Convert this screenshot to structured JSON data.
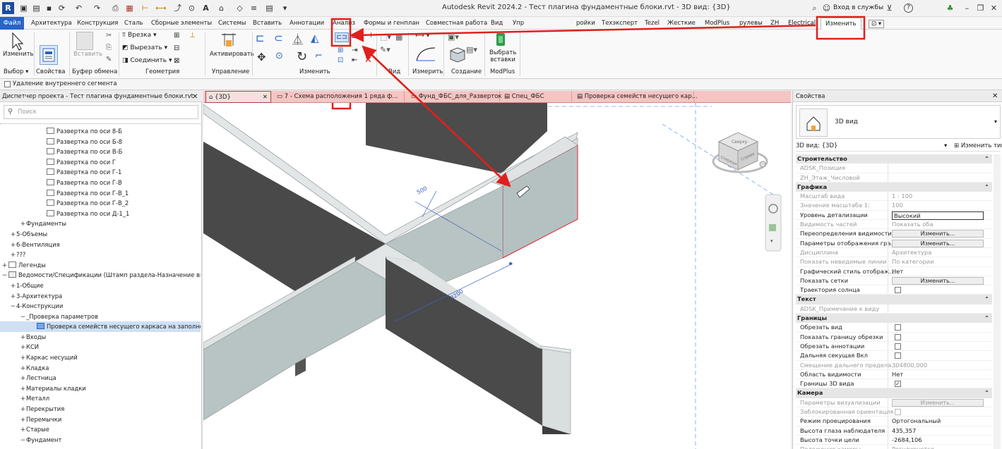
{
  "window": {
    "title": "Autodesk Revit 2024.2 - Тест плагина фундаментные блоки.rvt - 3D вид: {3D}",
    "sign_in": "Вход в службы",
    "help_icon": "?"
  },
  "ribbon_tabs": {
    "file": "Файл",
    "items": [
      "Архитектура",
      "Конструкция",
      "Сталь",
      "Сборные элементы",
      "Системы",
      "Вставить",
      "Аннотации",
      "Анализ",
      "Формы и генплан",
      "Совместная работа",
      "Вид",
      "Упр",
      "ройки",
      "Техэксперт",
      "Tezel",
      "Жесткие",
      "ModPlus",
      "рулевы",
      "ZH",
      "Electrical"
    ],
    "active": "Изменить"
  },
  "ribbon": {
    "modify_label": "Изменить",
    "paste_label": "Вставить",
    "cut_label": "Врезка",
    "cut2_label": "Вырезать",
    "join_label": "Соединить",
    "activate_label": "Активировать",
    "measure_label": "Измерить",
    "create_label": "Создание",
    "select_insert_label1": "Выбрать",
    "select_insert_label2": "вставки",
    "panels": {
      "select": "Выбор",
      "properties": "Свойства",
      "clipboard": "Буфер обмена",
      "geometry": "Геометрия",
      "control": "Управление",
      "modify": "Изменить",
      "view": "Вид",
      "measure": "Измерить",
      "create": "Создание",
      "modplus": "ModPlus"
    }
  },
  "options_bar": {
    "checkbox_label": "Удаление внутреннего сегмента"
  },
  "project_browser": {
    "header": "Диспетчер проекта - Тест плагина фундаментные блоки.rvt",
    "search_placeholder": "Поиск",
    "rows": [
      {
        "indent": 56,
        "toggle": "",
        "icon": "sheet",
        "label": "Развертка по оси 8-Б"
      },
      {
        "indent": 56,
        "toggle": "",
        "icon": "sheet",
        "label": "Развертка по оси Б-8"
      },
      {
        "indent": 56,
        "toggle": "",
        "icon": "sheet",
        "label": "Развертка по оси В-Б"
      },
      {
        "indent": 56,
        "toggle": "",
        "icon": "sheet",
        "label": "Развертка по оси Г"
      },
      {
        "indent": 56,
        "toggle": "",
        "icon": "sheet",
        "label": "Развертка по оси Г-1"
      },
      {
        "indent": 56,
        "toggle": "",
        "icon": "sheet",
        "label": "Развертка по оси Г-В"
      },
      {
        "indent": 56,
        "toggle": "",
        "icon": "sheet",
        "label": "Развертка по оси Г-В_1"
      },
      {
        "indent": 56,
        "toggle": "",
        "icon": "sheet",
        "label": "Развертка по оси Г-В_2"
      },
      {
        "indent": 56,
        "toggle": "",
        "icon": "sheet",
        "label": "Развертка по оси Д-1_1"
      },
      {
        "indent": 28,
        "toggle": "+",
        "icon": "",
        "label": "Фундаменты"
      },
      {
        "indent": 14,
        "toggle": "+",
        "icon": "",
        "label": "5-Объемы"
      },
      {
        "indent": 14,
        "toggle": "+",
        "icon": "",
        "label": "6-Вентиляция"
      },
      {
        "indent": 14,
        "toggle": "+",
        "icon": "",
        "label": "???"
      },
      {
        "indent": 2,
        "toggle": "+",
        "icon": "legend",
        "label": "Легенды"
      },
      {
        "indent": 2,
        "toggle": "−",
        "icon": "schedule",
        "label": "Ведомости/Спецификации (Штамп раздела-Назначение вид"
      },
      {
        "indent": 14,
        "toggle": "+",
        "icon": "",
        "label": "1-Общие"
      },
      {
        "indent": 14,
        "toggle": "+",
        "icon": "",
        "label": "3-Архитектура"
      },
      {
        "indent": 14,
        "toggle": "−",
        "icon": "",
        "label": "4-Конструкции"
      },
      {
        "indent": 28,
        "toggle": "−",
        "icon": "",
        "label": "_Проверка параметров"
      },
      {
        "indent": 42,
        "toggle": "",
        "icon": "schedule-sel",
        "label": "Проверка семейств несущего каркаса на заполнен",
        "selected": true
      },
      {
        "indent": 28,
        "toggle": "+",
        "icon": "",
        "label": "Входы"
      },
      {
        "indent": 28,
        "toggle": "+",
        "icon": "",
        "label": "КСИ"
      },
      {
        "indent": 28,
        "toggle": "+",
        "icon": "",
        "label": "Каркас несущий"
      },
      {
        "indent": 28,
        "toggle": "+",
        "icon": "",
        "label": "Кладка"
      },
      {
        "indent": 28,
        "toggle": "+",
        "icon": "",
        "label": "Лестница"
      },
      {
        "indent": 28,
        "toggle": "+",
        "icon": "",
        "label": "Материалы кладки"
      },
      {
        "indent": 28,
        "toggle": "+",
        "icon": "",
        "label": "Металл"
      },
      {
        "indent": 28,
        "toggle": "+",
        "icon": "",
        "label": "Перекрытия"
      },
      {
        "indent": 28,
        "toggle": "+",
        "icon": "",
        "label": "Перемычки"
      },
      {
        "indent": 28,
        "toggle": "+",
        "icon": "",
        "label": "Старые"
      },
      {
        "indent": 28,
        "toggle": "−",
        "icon": "",
        "label": "Фундамент"
      }
    ]
  },
  "view_tabs": [
    {
      "label": "{3D}",
      "active": true
    },
    {
      "label": "7 - Схема расположения 1 ряда ф..."
    },
    {
      "label": "Фунд_ФБС_для_Разверток"
    },
    {
      "label": "Спец_ФБС"
    },
    {
      "label": "Проверка семейств несущего кар..."
    }
  ],
  "viewport": {
    "dim_500": "500",
    "dim_3200": "3200",
    "viewcube_front": "Спереди",
    "viewcube_right": "Справа",
    "viewcube_top": "Сверху"
  },
  "properties": {
    "header": "Свойства",
    "type_name": "3D вид",
    "instance_filter": "3D вид: {3D}",
    "edit_type": "Изменить тип",
    "rows": [
      {
        "kind": "group",
        "label": "Строительство"
      },
      {
        "kind": "row",
        "label": "ADSK_Позиция",
        "dim": true
      },
      {
        "kind": "row",
        "label": "ZH_Этаж_Числовой",
        "dim": true
      },
      {
        "kind": "group",
        "label": "Графика"
      },
      {
        "kind": "row",
        "label": "Масштаб вида",
        "value": "1 : 100",
        "dim": true
      },
      {
        "kind": "row",
        "label": "Значение масштаба    1:",
        "value": "100",
        "dim": true
      },
      {
        "kind": "row",
        "label": "Уровень детализации",
        "value": "Высокий",
        "input": true
      },
      {
        "kind": "row",
        "label": "Видимость частей",
        "value": "Показать оба",
        "dim": true
      },
      {
        "kind": "row",
        "label": "Переопределения видимости...",
        "button": "Изменить..."
      },
      {
        "kind": "row",
        "label": "Параметры отображения гра...",
        "button": "Изменить..."
      },
      {
        "kind": "row",
        "label": "Дисциплина",
        "value": "Архитектура",
        "dim": true
      },
      {
        "kind": "row",
        "label": "Показать невидимые линии",
        "value": "По категории",
        "dim": true
      },
      {
        "kind": "row",
        "label": "Графический стиль отображ...",
        "value": "Нет"
      },
      {
        "kind": "row",
        "label": "Показать сетки",
        "button": "Изменить..."
      },
      {
        "kind": "row",
        "label": "Траектория солнца",
        "checkbox": false
      },
      {
        "kind": "group",
        "label": "Текст"
      },
      {
        "kind": "row",
        "label": "ADSK_Примечание к виду",
        "dim": true
      },
      {
        "kind": "group",
        "label": "Границы"
      },
      {
        "kind": "row",
        "label": "Обрезать вид",
        "checkbox": false
      },
      {
        "kind": "row",
        "label": "Показать границу обрезки",
        "checkbox": false
      },
      {
        "kind": "row",
        "label": "Обрезать аннотации",
        "checkbox": false
      },
      {
        "kind": "row",
        "label": "Дальняя секущая Вкл",
        "checkbox": false
      },
      {
        "kind": "row",
        "label": "Смещение дальнего предела...",
        "value": "304800,000",
        "dim": true
      },
      {
        "kind": "row",
        "label": "Область видимости",
        "value": "Нет"
      },
      {
        "kind": "row",
        "label": "Границы 3D вида",
        "checkbox": true
      },
      {
        "kind": "group",
        "label": "Камера"
      },
      {
        "kind": "row",
        "label": "Параметры визуализации",
        "button": "Изменить...",
        "dim": true
      },
      {
        "kind": "row",
        "label": "Заблокированная ориентация",
        "checkbox": false,
        "dim": true
      },
      {
        "kind": "row",
        "label": "Режим проецирования",
        "value": "Ортогональный"
      },
      {
        "kind": "row",
        "label": "Высота глаза наблюдателя",
        "value": "435,357"
      },
      {
        "kind": "row",
        "label": "Высота точки цели",
        "value": "-2684,106"
      },
      {
        "kind": "row",
        "label": "Положение камеры",
        "value": "Регулируется",
        "dim": true
      }
    ]
  },
  "colors": {
    "accent": "#2a64c6",
    "highlight_red": "#e0201c",
    "wall_top": "#d9dede",
    "wall_side": "#b6c2c2",
    "wall_dark": "#4a4a4a"
  }
}
